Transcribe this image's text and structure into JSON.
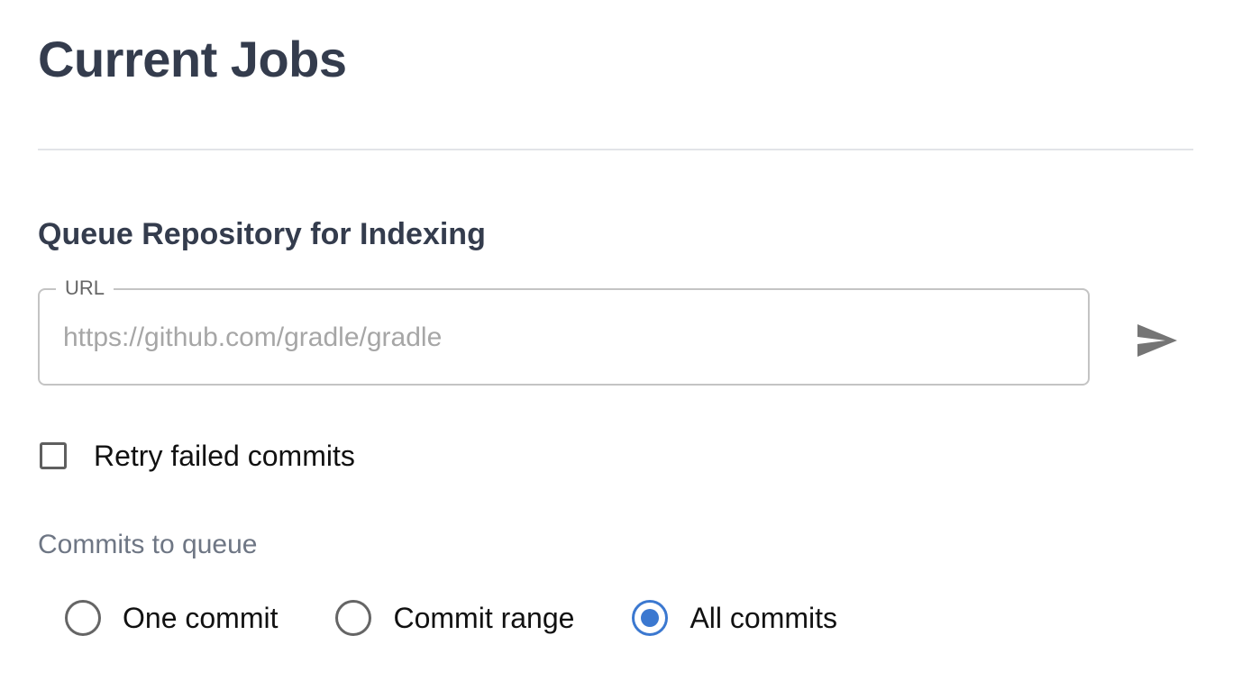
{
  "page": {
    "title": "Current Jobs"
  },
  "queue_form": {
    "section_title": "Queue Repository for Indexing",
    "url_field": {
      "label": "URL",
      "value": "",
      "placeholder": "https://github.com/gradle/gradle"
    },
    "submit_icon": "send-icon",
    "retry_checkbox": {
      "label": "Retry failed commits",
      "checked": false
    },
    "commits_group": {
      "label": "Commits to queue",
      "options": [
        {
          "label": "One commit",
          "selected": false
        },
        {
          "label": "Commit range",
          "selected": false
        },
        {
          "label": "All commits",
          "selected": true
        }
      ]
    }
  },
  "colors": {
    "heading": "#343c4d",
    "accent": "#3b78d0",
    "muted": "#6e7684"
  }
}
